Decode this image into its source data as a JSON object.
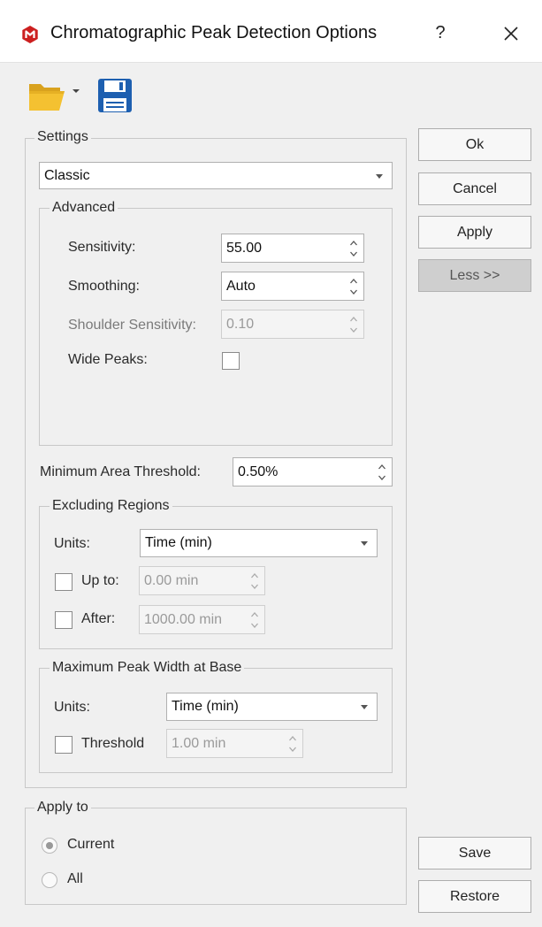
{
  "window": {
    "title": "Chromatographic Peak Detection Options",
    "help_label": "?",
    "accent_color": "#cc1f1f"
  },
  "toolbar": {
    "open_icon": "folder-open-icon",
    "save_icon": "floppy-save-icon"
  },
  "settings": {
    "legend": "Settings",
    "method_value": "Classic",
    "advanced": {
      "legend": "Advanced",
      "sensitivity_label": "Sensitivity:",
      "sensitivity_value": "55.00",
      "smoothing_label": "Smoothing:",
      "smoothing_value": "Auto",
      "shoulder_label": "Shoulder Sensitivity:",
      "shoulder_value": "0.10",
      "wide_peaks_label": "Wide Peaks:",
      "wide_peaks_checked": false
    },
    "min_area_label": "Minimum Area Threshold:",
    "min_area_value": "0.50%",
    "excluding": {
      "legend": "Excluding Regions",
      "units_label": "Units:",
      "units_value": "Time (min)",
      "upto_label": "Up to:",
      "upto_value": "0.00 min",
      "upto_checked": false,
      "after_label": "After:",
      "after_value": "1000.00 min",
      "after_checked": false
    },
    "max_width": {
      "legend": "Maximum Peak Width at Base",
      "units_label": "Units:",
      "units_value": "Time (min)",
      "threshold_label": "Threshold",
      "threshold_value": "1.00 min",
      "threshold_checked": false
    }
  },
  "apply_to": {
    "legend": "Apply to",
    "current_label": "Current",
    "all_label": "All",
    "selected": "Current"
  },
  "buttons": {
    "ok": "Ok",
    "cancel": "Cancel",
    "apply": "Apply",
    "less": "Less >>",
    "save": "Save",
    "restore": "Restore"
  }
}
